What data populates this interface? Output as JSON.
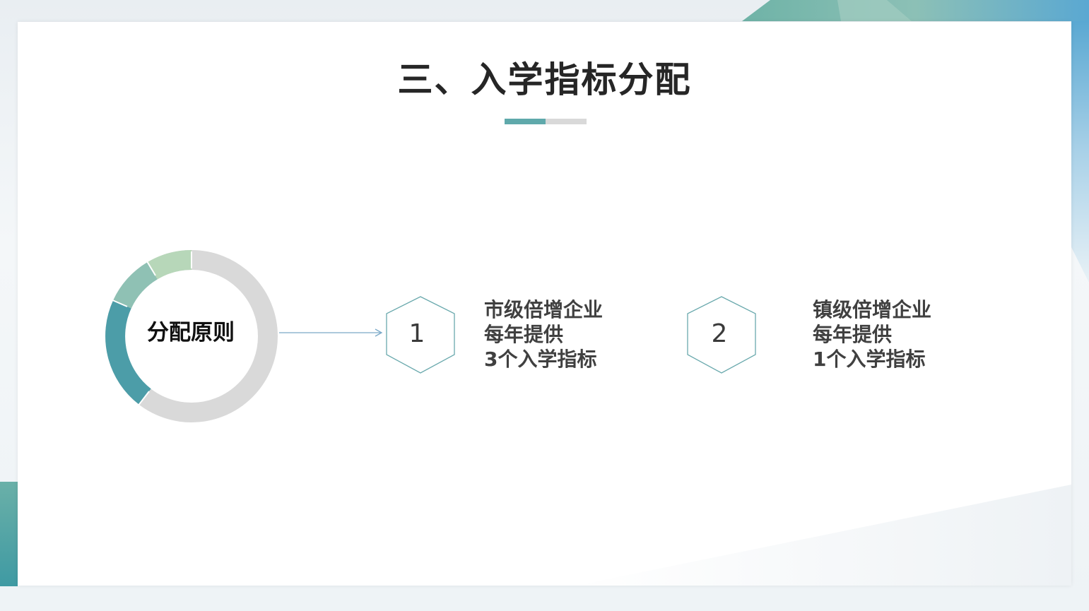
{
  "slide": {
    "title": "三、入学指标分配",
    "colors": {
      "accent_teal": "#5fa9ab",
      "accent_teal_dark": "#4c9da8",
      "accent_sage": "#8fc1b4",
      "accent_green_light": "#b7d7b9",
      "ring_gray": "#d9d9d9",
      "text_dark": "#262626",
      "text_body": "#404040"
    }
  },
  "principle": {
    "label": "分配原则",
    "ring_share_gray": 0.67
  },
  "items": [
    {
      "number": "1",
      "lines": [
        "市级倍增企业",
        "每年提供",
        "3个入学指标"
      ],
      "shape": "hexagon-outline-icon"
    },
    {
      "number": "2",
      "lines": [
        "镇级倍增企业",
        "每年提供",
        "1个入学指标"
      ],
      "shape": "hexagon-outline-icon"
    }
  ]
}
